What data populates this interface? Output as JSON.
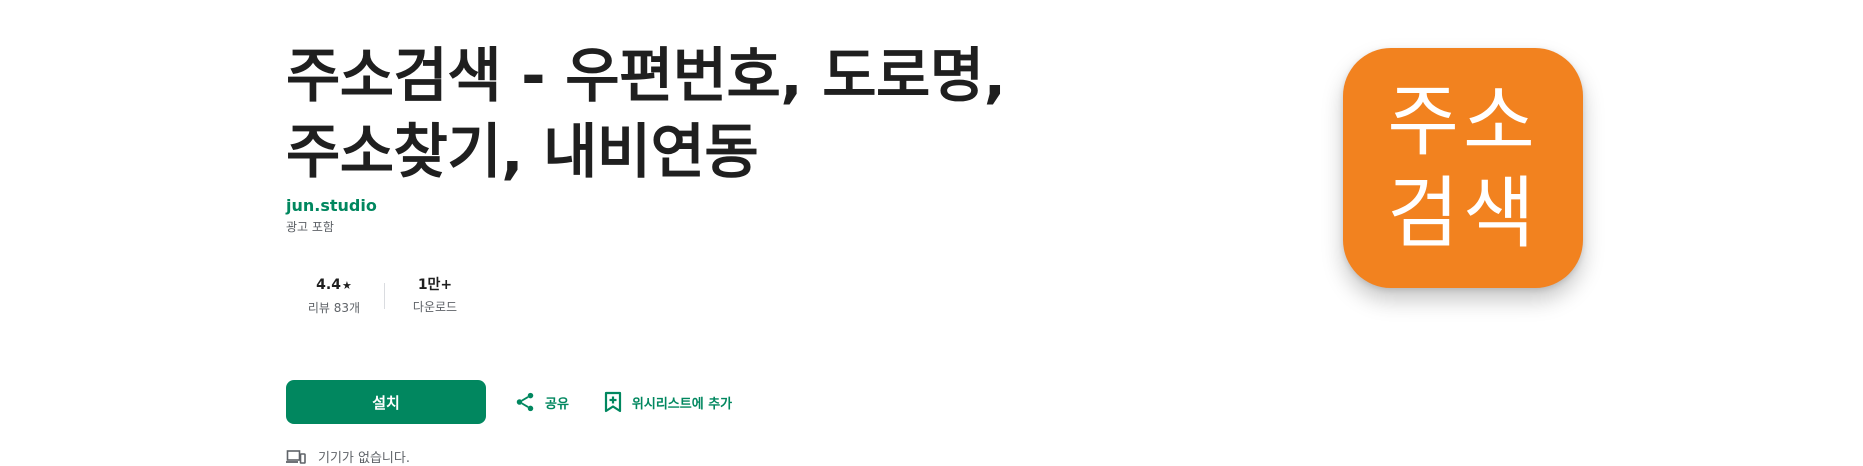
{
  "app": {
    "title_line1": "주소검색 - 우편번호, 도로명,",
    "title_line2": "주소찾기, 내비연동",
    "developer": "jun.studio",
    "ads_note": "광고 포함"
  },
  "stats": {
    "rating_value": "4.4",
    "rating_star": "★",
    "reviews_label": "리뷰 83개",
    "downloads_value": "1만+",
    "downloads_label": "다운로드"
  },
  "actions": {
    "install_label": "설치",
    "share_label": "공유",
    "wishlist_label": "위시리스트에 추가"
  },
  "device_note": "기기가 없습니다.",
  "icon": {
    "line1": "주소",
    "line2": "검색",
    "background": "#f2821f"
  },
  "colors": {
    "accent": "#01875f",
    "text_primary": "#1f1f1f",
    "text_secondary": "#5f6368"
  },
  "icons": {
    "share": "share-icon",
    "wishlist": "bookmark-add-icon",
    "device": "devices-icon"
  }
}
